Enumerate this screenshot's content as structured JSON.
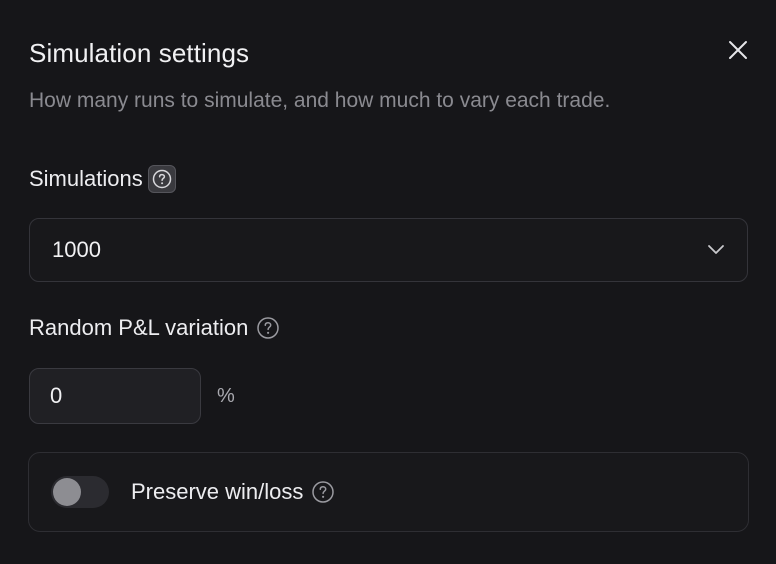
{
  "dialog": {
    "title": "Simulation settings",
    "subtitle": "How many runs to simulate, and how much to vary each trade.",
    "close_icon": "close-icon"
  },
  "simulations": {
    "label": "Simulations",
    "help_icon": "question-circle-icon",
    "selected": "1000",
    "chevron_icon": "chevron-down-icon"
  },
  "variation": {
    "label": "Random P&L variation",
    "help_icon": "question-circle-icon",
    "value": "0",
    "unit": "%"
  },
  "preserve": {
    "label": "Preserve win/loss",
    "help_icon": "question-circle-icon",
    "enabled": false
  },
  "colors": {
    "background": "#161619",
    "text": "#ededf0",
    "muted": "#8a8a90",
    "border": "#34343a"
  }
}
